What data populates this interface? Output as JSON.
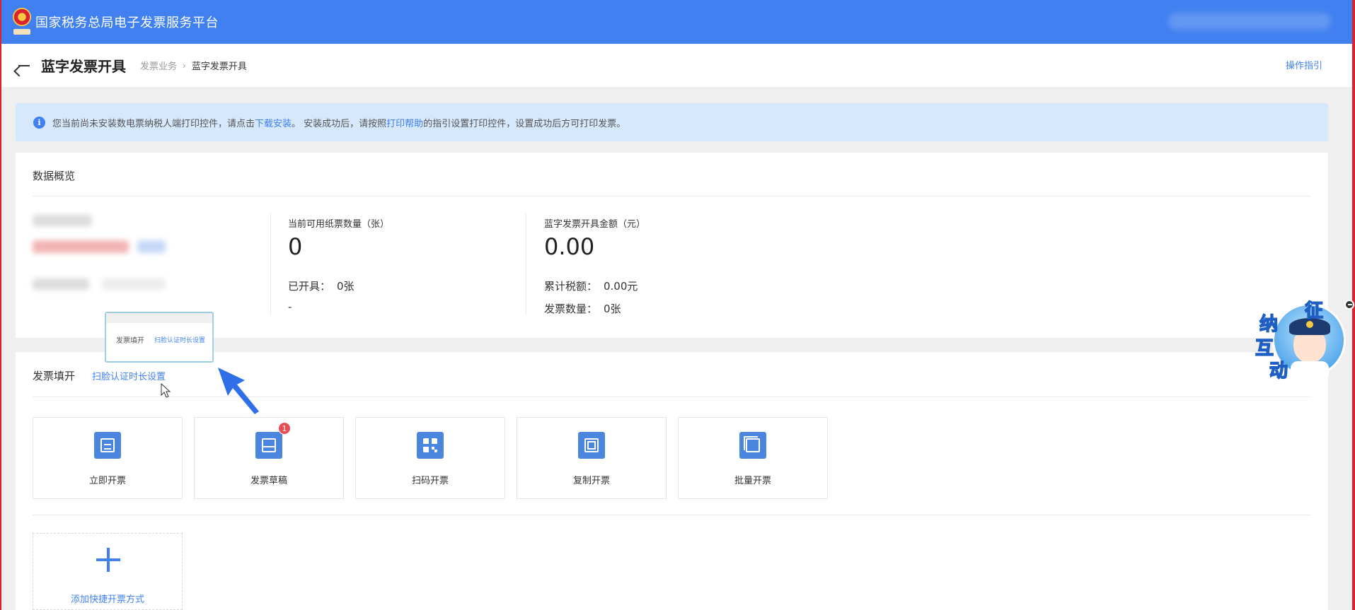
{
  "topbar": {
    "platform_title": "国家税务总局电子发票服务平台",
    "emblem_icon": "national-emblem-icon",
    "brand_color": "#4180f0"
  },
  "header": {
    "page_title": "蓝字发票开具",
    "breadcrumb": [
      "发票业务",
      "蓝字发票开具"
    ],
    "breadcrumb_separator": "›",
    "guide_link": "操作指引"
  },
  "notice": {
    "text_before": "您当前尚未安装数电票纳税人端打印控件，请点击",
    "download_link": "下载安装",
    "text_middle": "。 安装成功后，请按照",
    "help_link": "打印帮助",
    "text_after": "的指引设置打印控件，设置成功后方可打印发票。"
  },
  "overview": {
    "title": "数据概览",
    "paper": {
      "label": "当前可用纸票数量（张）",
      "value": "0",
      "issued_label": "已开具：",
      "issued_value": "0张",
      "extra": "-"
    },
    "amount": {
      "label": "蓝字发票开具金额（元）",
      "value": "0.00",
      "tax_label": "累计税额：",
      "tax_value": "0.00元",
      "count_label": "发票数量：",
      "count_value": "0张"
    }
  },
  "tooltip_preview": {
    "label": "发票填开",
    "link": "扫脸认证时长设置"
  },
  "issue": {
    "title": "发票填开",
    "face_auth_link": "扫脸认证时长设置",
    "cards": [
      {
        "label": "立即开票",
        "icon": "ticket-icon"
      },
      {
        "label": "发票草稿",
        "icon": "inbox-icon",
        "badge": "1"
      },
      {
        "label": "扫码开票",
        "icon": "qr-code-icon"
      },
      {
        "label": "复制开票",
        "icon": "copy-icon"
      },
      {
        "label": "批量开票",
        "icon": "batch-icon"
      }
    ],
    "add_label": "添加快捷开票方式"
  },
  "mascot": {
    "chars": [
      "征",
      "纳",
      "互",
      "动"
    ]
  }
}
